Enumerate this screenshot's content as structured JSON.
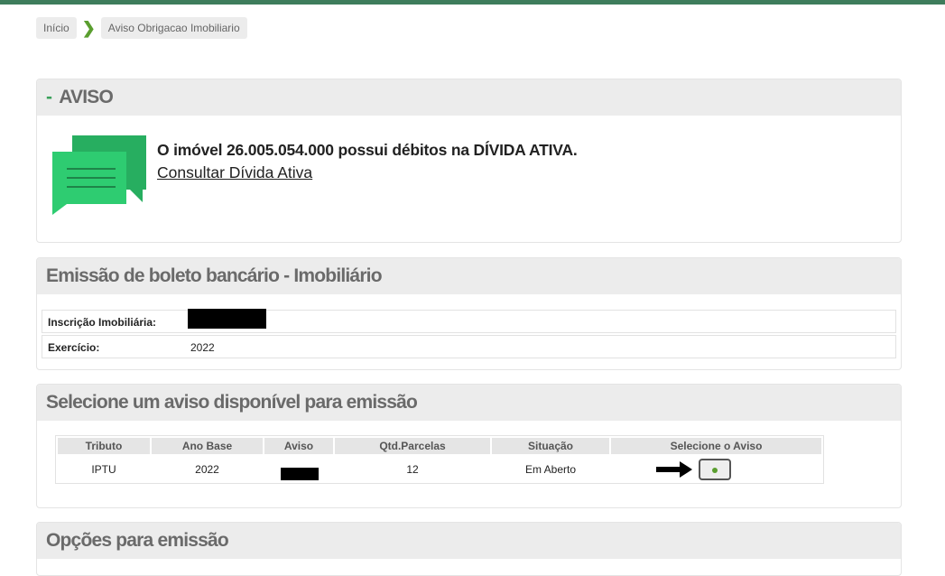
{
  "breadcrumb": {
    "home": "Início",
    "current": "Aviso Obrigacao Imobiliario"
  },
  "aviso_panel": {
    "dash": "-",
    "title": "AVISO",
    "message": "O imóvel 26.005.054.000 possui débitos na DÍVIDA ATIVA.",
    "link": "Consultar Dívida Ativa",
    "icon": "chat-bubbles-icon"
  },
  "emissao_panel": {
    "title": "Emissão de boleto bancário - Imobiliário",
    "rows": [
      {
        "label": "Inscrição Imobiliária:",
        "value": ""
      },
      {
        "label": "Exercício:",
        "value": "2022"
      }
    ]
  },
  "selecione_panel": {
    "title": "Selecione um aviso disponível para emissão",
    "columns": [
      "Tributo",
      "Ano Base",
      "Aviso",
      "Qtd.Parcelas",
      "Situação",
      "Selecione o Aviso"
    ],
    "rows": [
      {
        "tributo": "IPTU",
        "ano_base": "2022",
        "aviso": "",
        "qtd_parcelas": "12",
        "situacao": "Em Aberto",
        "selected": true
      }
    ]
  },
  "opcoes_panel": {
    "title": "Opções para emissão"
  },
  "colors": {
    "accent_green": "#3e7d5c",
    "icon_green": "#2ecc71",
    "chevron_green": "#5a9e2f"
  }
}
